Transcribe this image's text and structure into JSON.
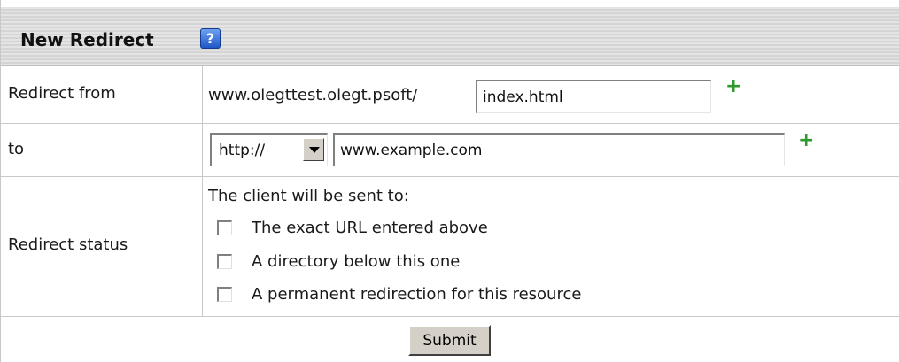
{
  "header": {
    "title": "New Redirect",
    "help_icon": "?"
  },
  "redirect_from": {
    "label": "Redirect from",
    "domain_prefix": "www.olegttest.olegt.psoft/",
    "path_value": "index.html",
    "add_icon": "+"
  },
  "redirect_to": {
    "label": "to",
    "protocol_selected": "http://",
    "url_value": "www.example.com",
    "add_icon": "+"
  },
  "redirect_status": {
    "label": "Redirect status",
    "intro": "The client will be sent to:",
    "options": [
      {
        "label": "The exact URL entered above",
        "checked": false
      },
      {
        "label": "A directory below this one",
        "checked": false
      },
      {
        "label": "A permanent redirection for this resource",
        "checked": false
      }
    ]
  },
  "submit": {
    "label": "Submit"
  }
}
